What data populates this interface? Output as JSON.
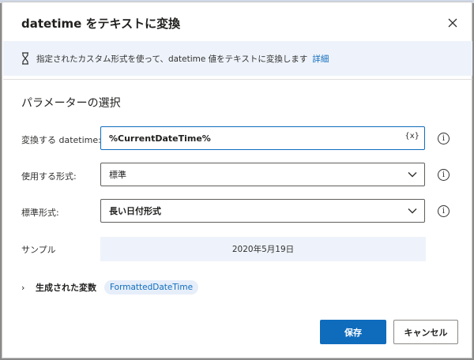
{
  "dialog": {
    "title": "datetime をテキストに変換",
    "close_icon": "close-icon"
  },
  "info": {
    "text": "指定されたカスタム形式を使って、datetime 値をテキストに変換します",
    "link": "詳細"
  },
  "section": {
    "title": "パラメーターの選択"
  },
  "params": {
    "datetime": {
      "label": "変換する datetime:",
      "value": "%CurrentDateTime%",
      "var_badge": "{x}"
    },
    "format_type": {
      "label": "使用する形式:",
      "value": "標準"
    },
    "standard_format": {
      "label": "標準形式:",
      "value": "長い日付形式"
    },
    "sample": {
      "label": "サンプル",
      "value": "2020年5月19日"
    }
  },
  "generated": {
    "label": "生成された変数",
    "variable": "FormattedDateTime"
  },
  "buttons": {
    "save": "保存",
    "cancel": "キャンセル"
  },
  "colors": {
    "accent": "#0f6cbd",
    "info_bg": "#eef3fb"
  }
}
